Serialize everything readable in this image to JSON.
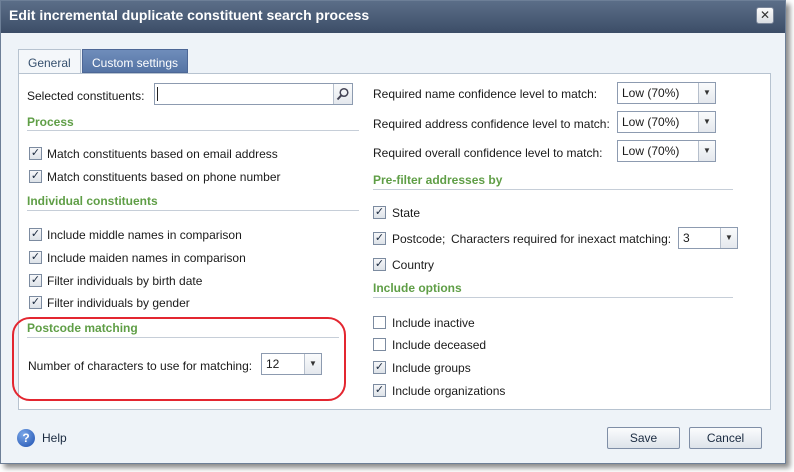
{
  "window": {
    "title": "Edit incremental duplicate constituent search process",
    "close_glyph": "✕"
  },
  "tabs": [
    {
      "label": "General",
      "selected": false
    },
    {
      "label": "Custom settings",
      "selected": true
    }
  ],
  "left": {
    "selected_constituents_label": "Selected constituents:",
    "selected_constituents_value": "",
    "process": {
      "title": "Process",
      "items": [
        {
          "label": "Match constituents based on email address",
          "checked": true
        },
        {
          "label": "Match constituents based on phone number",
          "checked": true
        }
      ]
    },
    "individual": {
      "title": "Individual constituents",
      "items": [
        {
          "label": "Include middle names in comparison",
          "checked": true
        },
        {
          "label": "Include maiden names in comparison",
          "checked": true
        },
        {
          "label": "Filter individuals by birth date",
          "checked": true
        },
        {
          "label": "Filter individuals by gender",
          "checked": true
        }
      ]
    },
    "postcode": {
      "title": "Postcode matching",
      "chars_label": "Number of characters to use for matching:",
      "chars_value": "12"
    }
  },
  "right": {
    "confidence": [
      {
        "label": "Required name confidence level to match:",
        "value": "Low (70%)"
      },
      {
        "label": "Required address confidence level to match:",
        "value": "Low (70%)"
      },
      {
        "label": "Required overall confidence level to match:",
        "value": "Low (70%)"
      }
    ],
    "prefilter": {
      "title": "Pre-filter addresses by",
      "state": {
        "label": "State",
        "checked": true
      },
      "postcode": {
        "label": "Postcode;",
        "checked": true
      },
      "inexact_label": "Characters required for inexact matching:",
      "inexact_value": "3",
      "country": {
        "label": "Country",
        "checked": true
      }
    },
    "include": {
      "title": "Include options",
      "items": [
        {
          "label": "Include inactive",
          "checked": false
        },
        {
          "label": "Include deceased",
          "checked": false
        },
        {
          "label": "Include groups",
          "checked": true
        },
        {
          "label": "Include organizations",
          "checked": true
        }
      ]
    }
  },
  "footer": {
    "help_label": "Help",
    "save_label": "Save",
    "cancel_label": "Cancel"
  },
  "icons": {
    "help": "help-icon",
    "search": "search-icon",
    "dropdown": "chevron-down-icon",
    "check": "✓"
  },
  "colors": {
    "section_title": "#5f9e46",
    "highlight": "#e32630",
    "titlebar": "#4a5c77",
    "tab_active": "#5f7fb1"
  }
}
